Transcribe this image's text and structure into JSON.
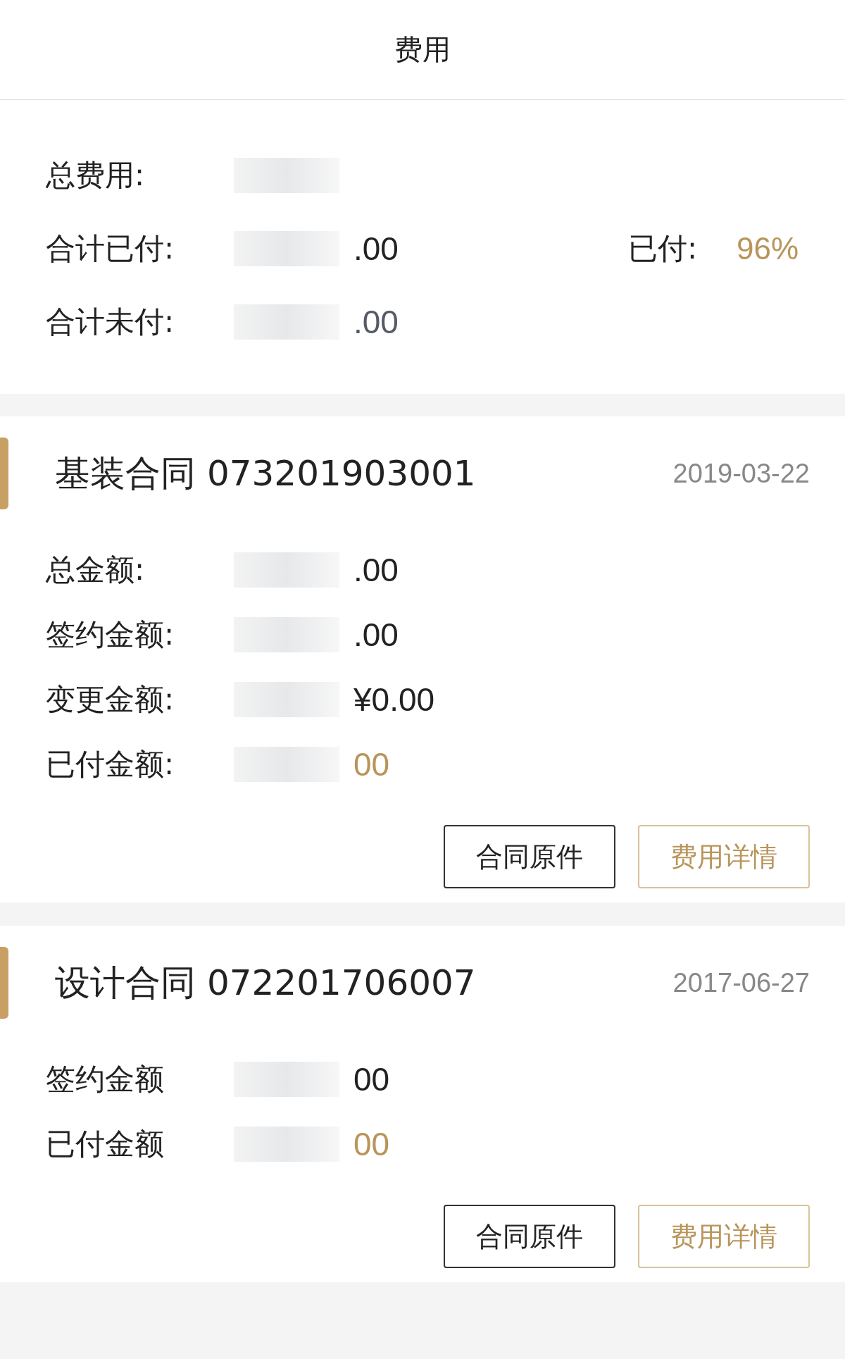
{
  "header": {
    "title": "费用"
  },
  "summary": {
    "rows": [
      {
        "label": "总费用:"
      },
      {
        "label": "合计已付:",
        "value": ".00",
        "kind": "normal"
      },
      {
        "label": "合计未付:",
        "value": ".00",
        "kind": "muted"
      }
    ],
    "paid_label": "已付:",
    "paid_percent": "96%"
  },
  "contracts": [
    {
      "name": "基装合同",
      "number": "073201903001",
      "date": "2019-03-22",
      "rows": [
        {
          "label": "总金额:",
          "value": ".00",
          "kind": "normal"
        },
        {
          "label": "签约金额:",
          "value": ".00",
          "kind": "normal"
        },
        {
          "label": "变更金额:",
          "value": "¥0.00",
          "kind": "normal"
        },
        {
          "label": "已付金额:",
          "value": "00",
          "kind": "gold"
        }
      ],
      "buttons": [
        {
          "label": "合同原件",
          "kind": "plain"
        },
        {
          "label": "费用详情",
          "kind": "gold"
        }
      ]
    },
    {
      "name": "设计合同",
      "number": "072201706007",
      "date": "2017-06-27",
      "rows": [
        {
          "label": "签约金额",
          "value": "00",
          "kind": "normal"
        },
        {
          "label": "已付金额",
          "value": "00",
          "kind": "gold"
        }
      ],
      "buttons": [
        {
          "label": "合同原件",
          "kind": "plain"
        },
        {
          "label": "费用详情",
          "kind": "gold"
        }
      ]
    }
  ]
}
